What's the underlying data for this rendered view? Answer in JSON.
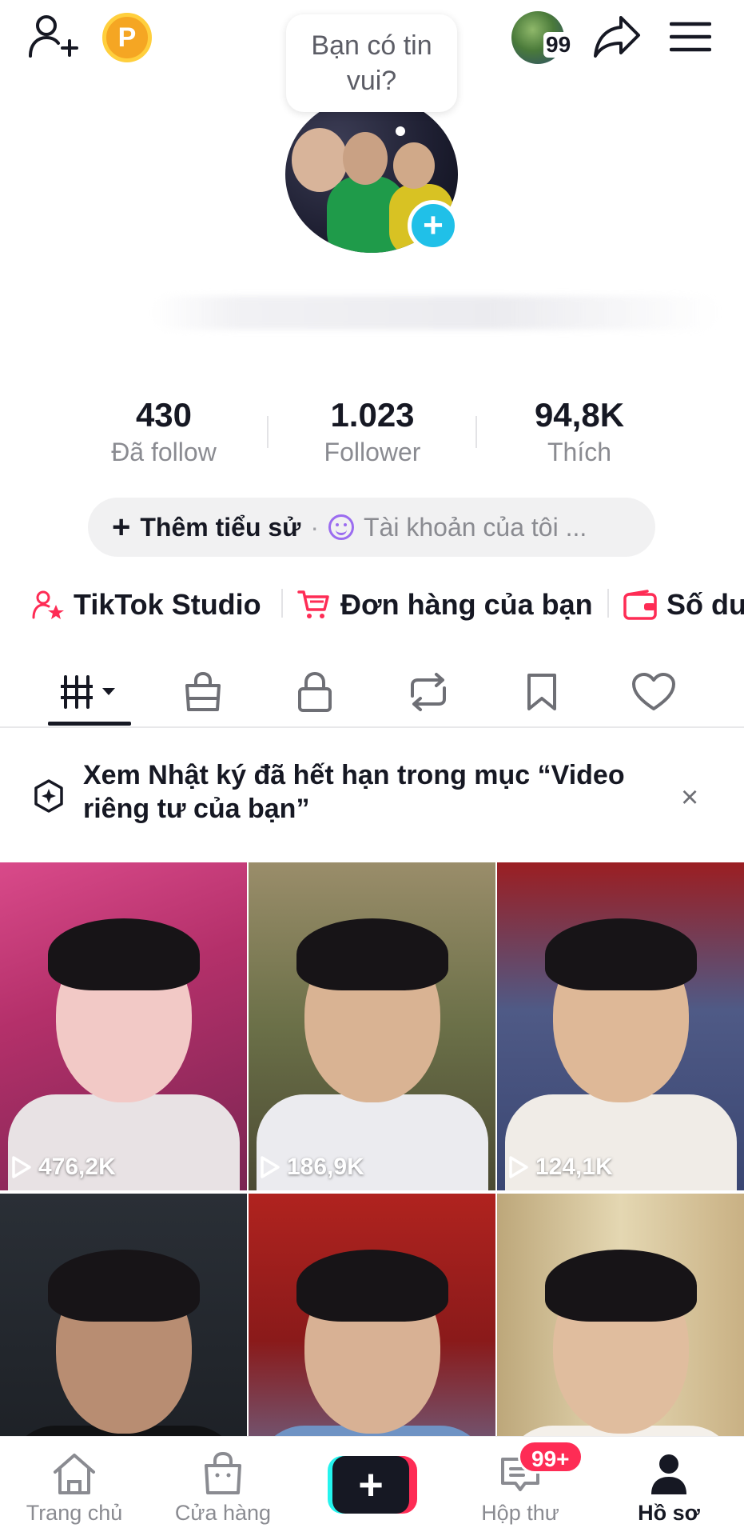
{
  "header": {
    "story_count": "99",
    "icons": [
      "add-friend-icon",
      "coin-icon",
      "share-icon",
      "menu-icon"
    ]
  },
  "profile": {
    "bubble_text": "Bạn có tin vui?",
    "add_avatar_symbol": "+"
  },
  "stats": [
    {
      "value": "430",
      "label": "Đã follow"
    },
    {
      "value": "1.023",
      "label": "Follower"
    },
    {
      "value": "94,8K",
      "label": "Thích"
    }
  ],
  "bio": {
    "add_label": "Thêm tiểu sử",
    "account_label": "Tài khoản của tôi ..."
  },
  "links": [
    {
      "label": "TikTok Studio"
    },
    {
      "label": "Đơn hàng của bạn"
    },
    {
      "label": "Số dư"
    }
  ],
  "tabs": [
    "videos-grid",
    "shop",
    "private",
    "reposts",
    "favorites",
    "liked"
  ],
  "notice": {
    "text": "Xem Nhật ký đã hết hạn trong mục “Video riêng tư của bạn”",
    "close": "×"
  },
  "videos": [
    {
      "views": "476,2K"
    },
    {
      "views": "186,9K"
    },
    {
      "views": "124,1K"
    },
    {
      "views": ""
    },
    {
      "views": ""
    },
    {
      "views": ""
    }
  ],
  "bottom_nav": {
    "home": "Trang chủ",
    "shop": "Cửa hàng",
    "create": "+",
    "inbox": "Hộp thư",
    "inbox_badge": "99+",
    "profile": "Hồ sơ"
  },
  "colors": {
    "accent_red": "#fe2c55",
    "accent_cyan": "#25f4ee",
    "add_button": "#20c0e8",
    "text_primary": "#161823",
    "text_secondary": "#8a8b91"
  }
}
